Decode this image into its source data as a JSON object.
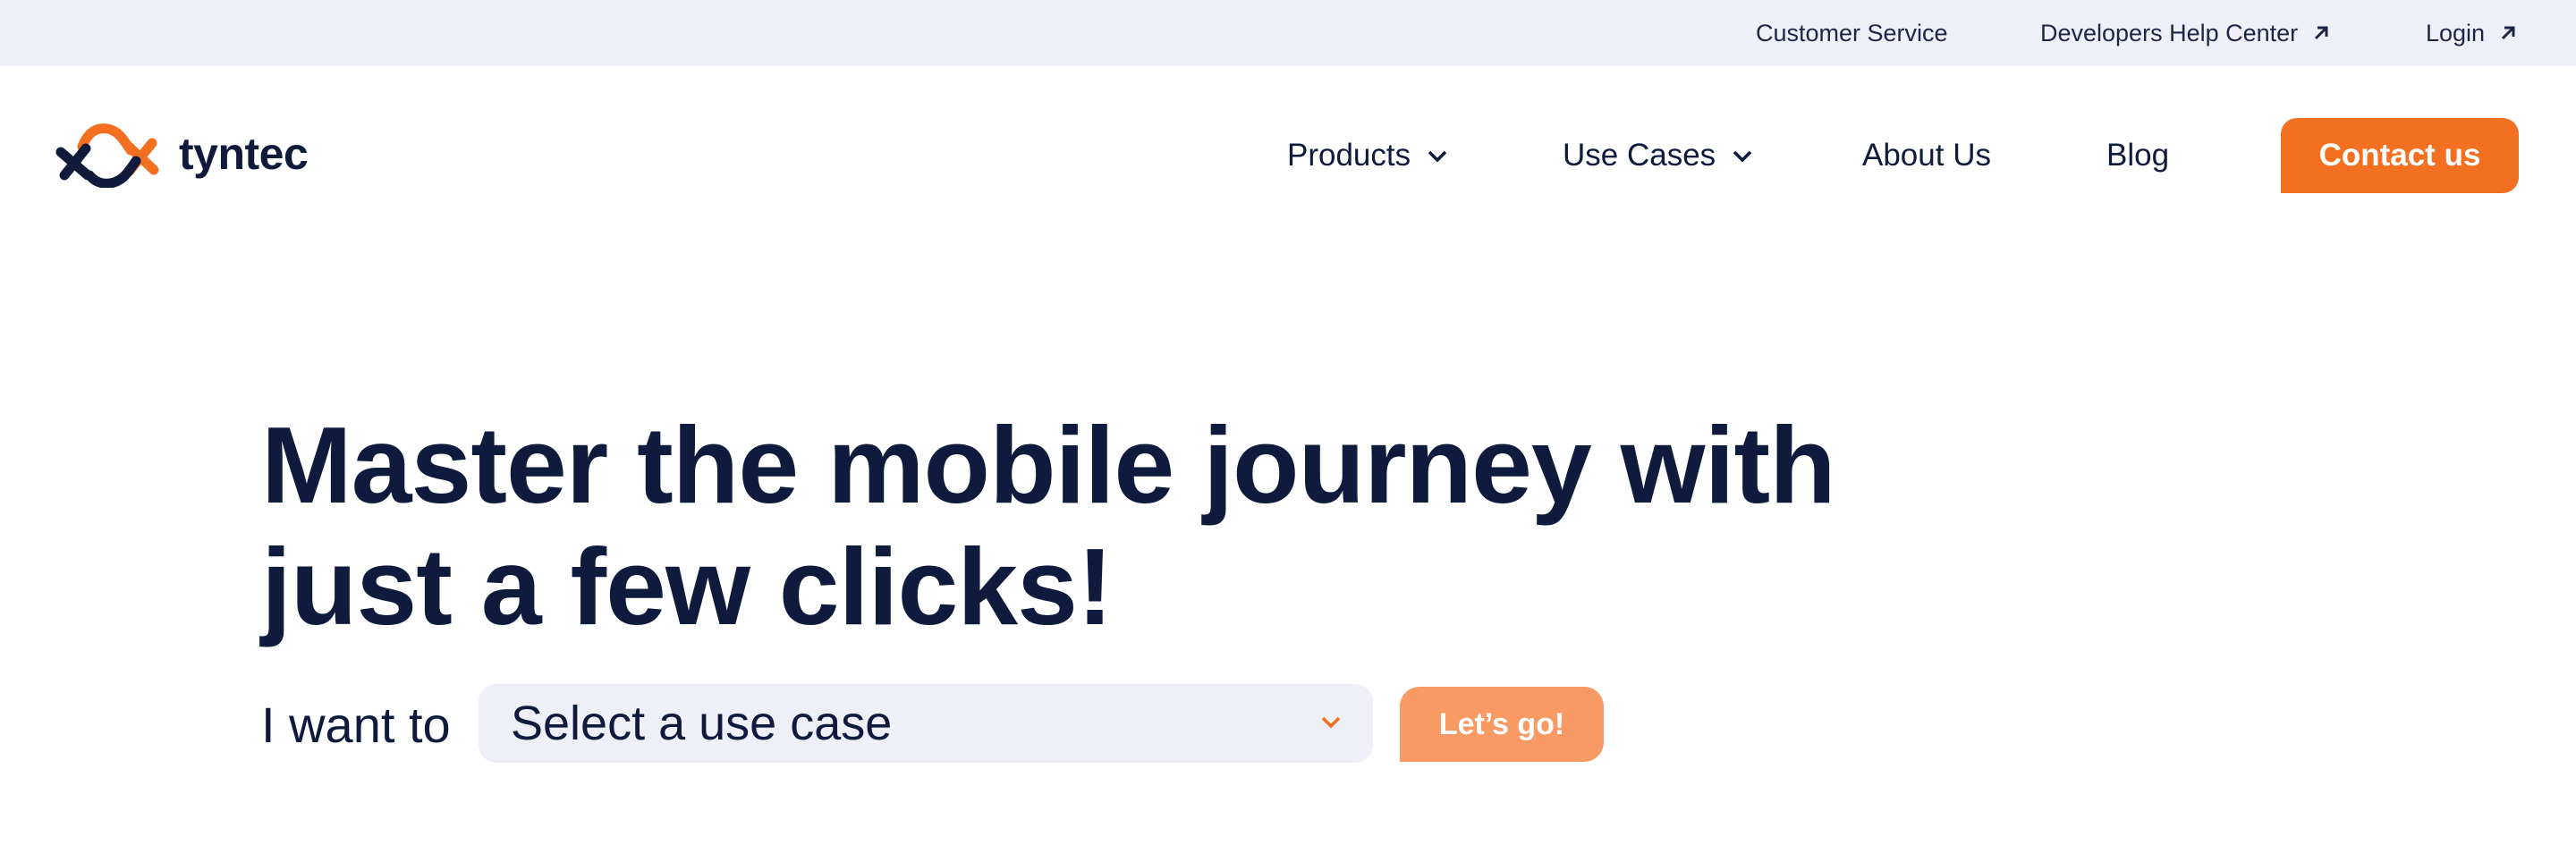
{
  "topbar": {
    "customer_service": "Customer Service",
    "dev_help": "Developers Help Center",
    "login": "Login",
    "external_icon": "arrow-up-right-icon"
  },
  "brand": {
    "name": "tyntec",
    "logo_icon": "tyntec-logo-icon",
    "accent": "#f37021",
    "navy": "#0f1b3d"
  },
  "nav": {
    "products": "Products",
    "use_cases": "Use Cases",
    "about": "About Us",
    "blog": "Blog",
    "contact": "Contact us",
    "chevron_icon": "chevron-down-icon"
  },
  "hero": {
    "title_line1": "Master the mobile journey with",
    "title_line2": "just a few clicks!",
    "want_label": "I want to",
    "select_value": "Select a use case",
    "cta": "Let’s go!"
  },
  "colors": {
    "topbar_bg": "#efeff7",
    "select_bg": "#eeeff7",
    "cta_disabled": "#f79a63"
  }
}
